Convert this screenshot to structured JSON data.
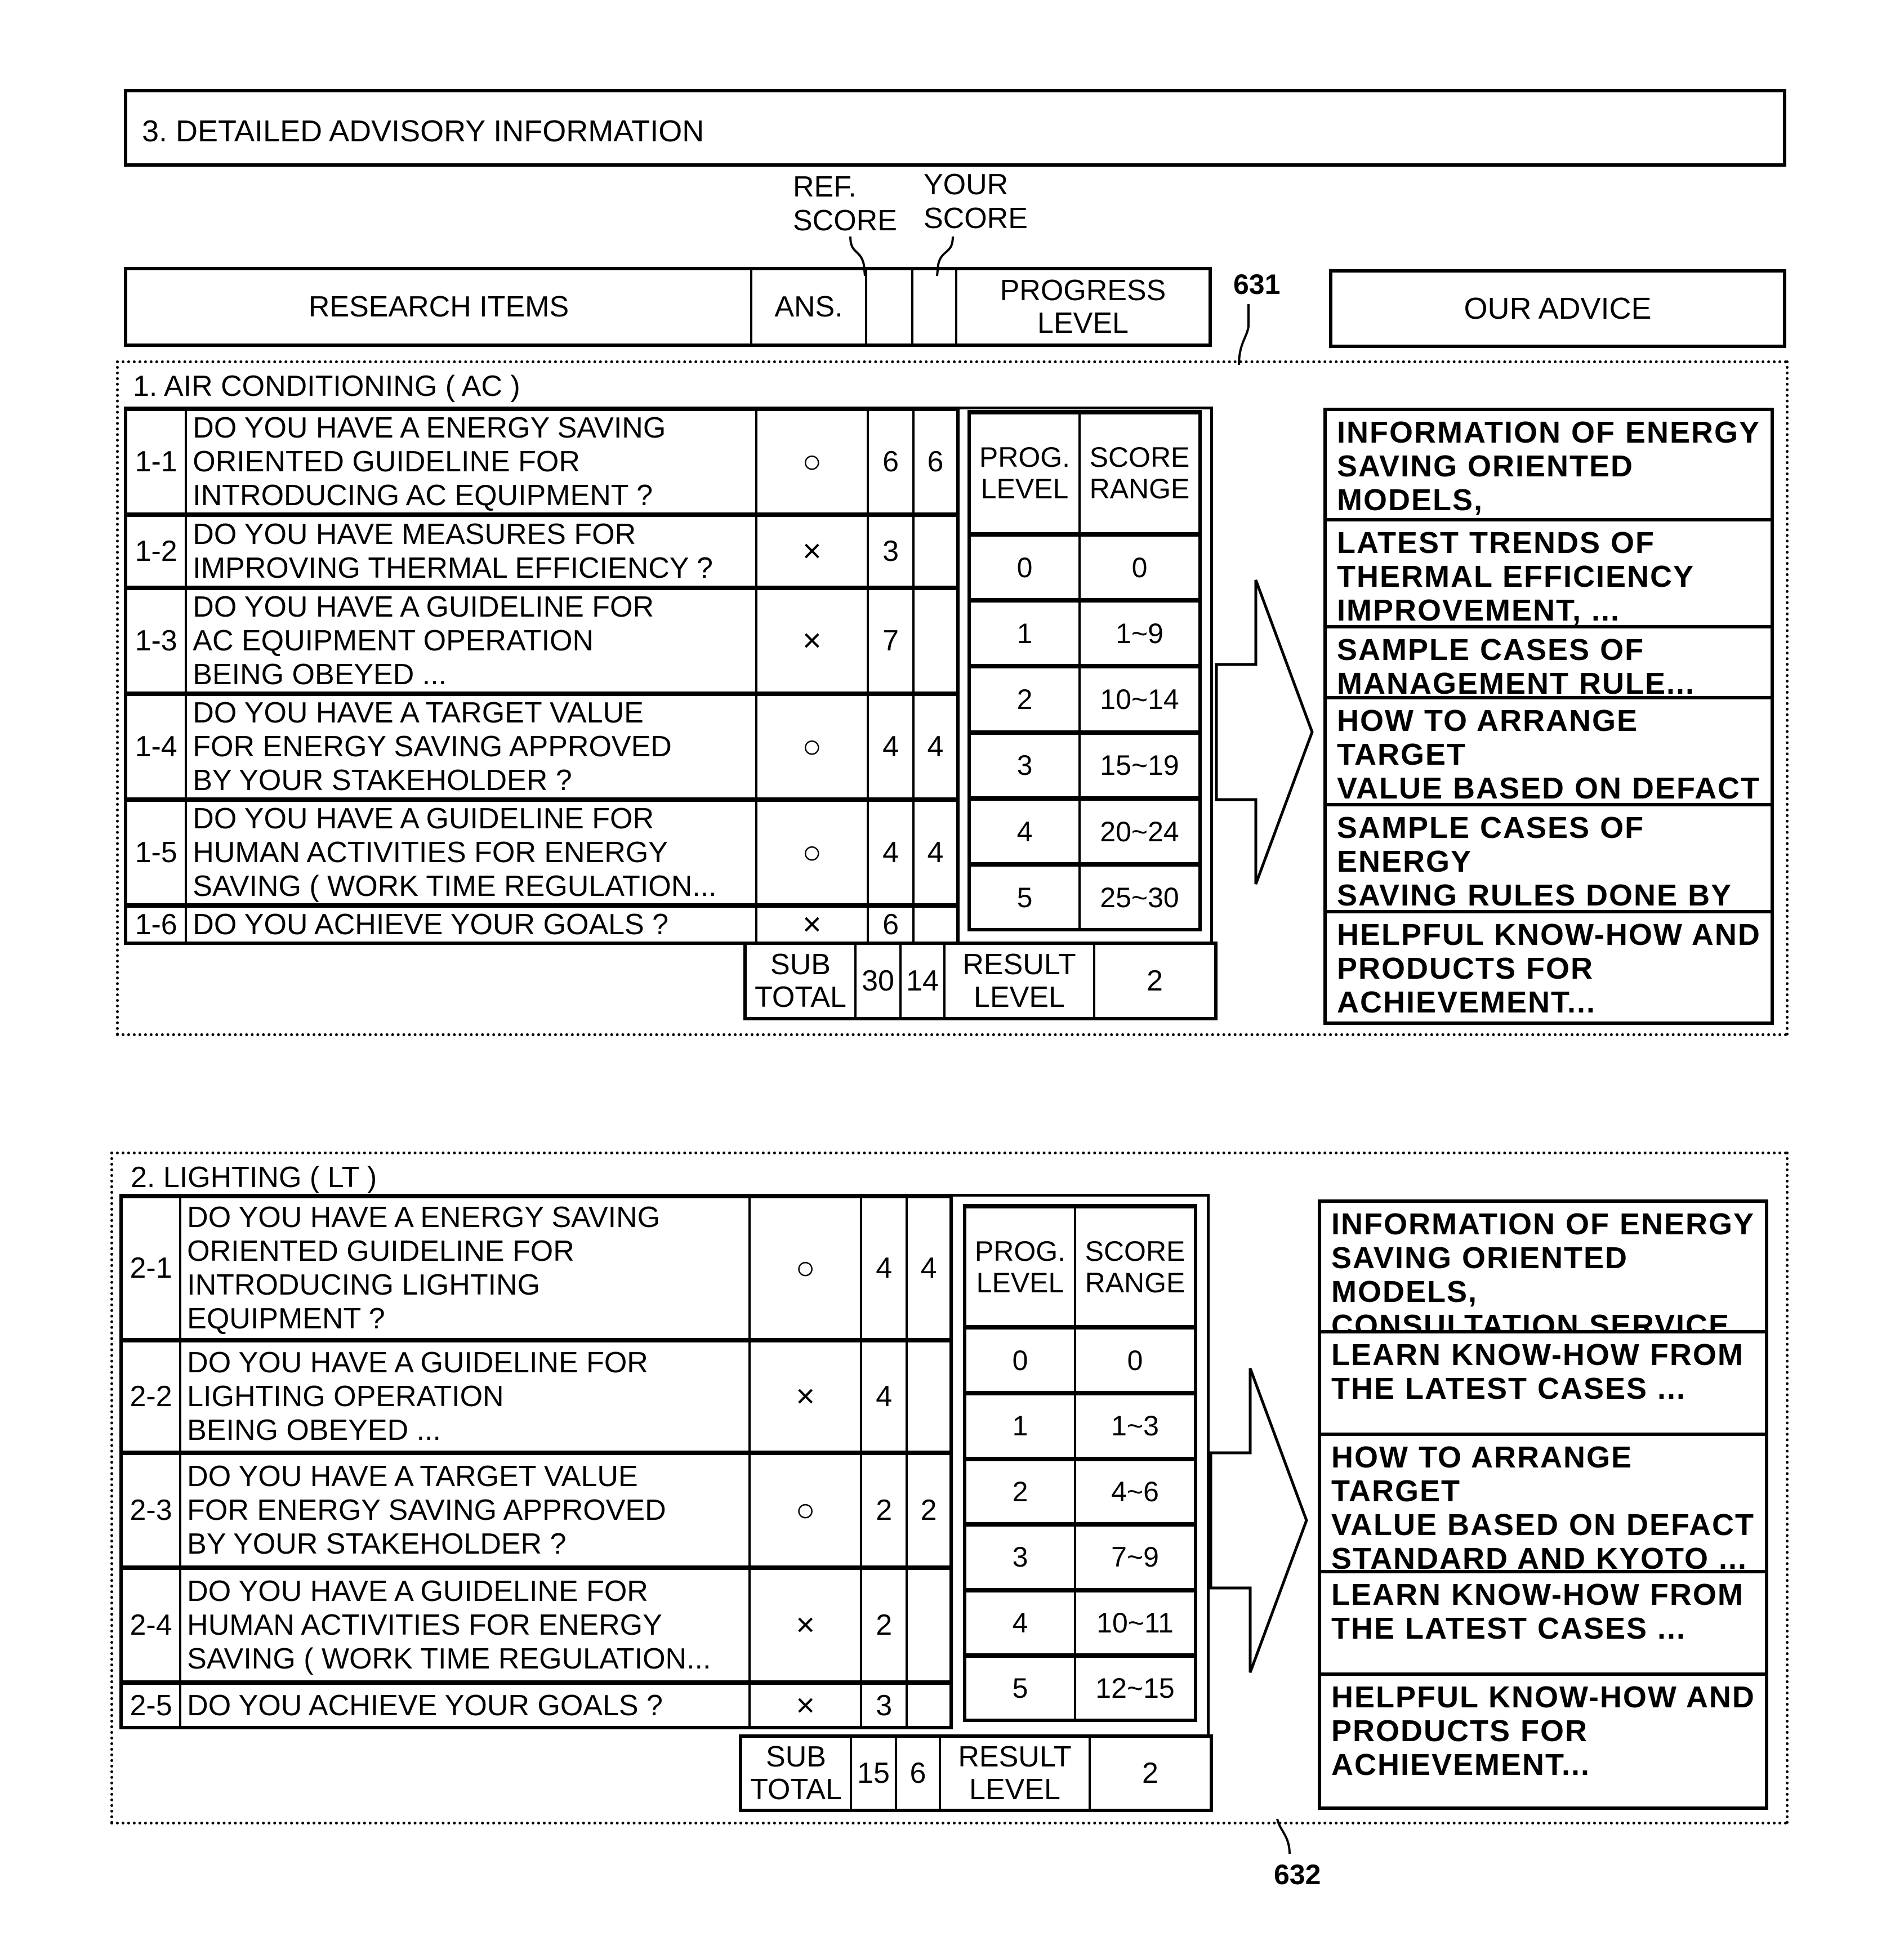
{
  "title": "3. DETAILED ADVISORY INFORMATION",
  "labels": {
    "ref_score": "REF.\nSCORE",
    "your_score": "YOUR\nSCORE",
    "ref_631": "631",
    "ref_632": "632"
  },
  "header": {
    "research_items": "RESEARCH ITEMS",
    "ans": "ANS.",
    "progress_level": "PROGRESS LEVEL",
    "our_advice": "OUR ADVICE"
  },
  "sections": [
    {
      "title": "1. AIR CONDITIONING ( AC )",
      "items": [
        {
          "id": "1-1",
          "question": "DO YOU HAVE A ENERGY SAVING\nORIENTED GUIDELINE FOR\nINTRODUCING AC EQUIPMENT ?",
          "ans": "○",
          "ref": "6",
          "yours": "6"
        },
        {
          "id": "1-2",
          "question": "DO YOU HAVE MEASURES FOR\nIMPROVING THERMAL EFFICIENCY ?",
          "ans": "×",
          "ref": "3",
          "yours": ""
        },
        {
          "id": "1-3",
          "question": "DO YOU HAVE A GUIDELINE FOR\nAC EQUIPMENT OPERATION\nBEING OBEYED ...",
          "ans": "×",
          "ref": "7",
          "yours": ""
        },
        {
          "id": "1-4",
          "question": "DO YOU HAVE A TARGET VALUE\nFOR ENERGY SAVING APPROVED\nBY YOUR STAKEHOLDER ?",
          "ans": "○",
          "ref": "4",
          "yours": "4"
        },
        {
          "id": "1-5",
          "question": "DO YOU HAVE A GUIDELINE FOR\nHUMAN ACTIVITIES FOR ENERGY\nSAVING ( WORK TIME REGULATION...",
          "ans": "○",
          "ref": "4",
          "yours": "4"
        },
        {
          "id": "1-6",
          "question": "DO YOU ACHIEVE YOUR GOALS ?",
          "ans": "×",
          "ref": "6",
          "yours": ""
        }
      ],
      "progress_table": {
        "col1": "PROG.\nLEVEL",
        "col2": "SCORE\nRANGE",
        "rows": [
          {
            "level": "0",
            "range": "0"
          },
          {
            "level": "1",
            "range": "1~9"
          },
          {
            "level": "2",
            "range": "10~14"
          },
          {
            "level": "3",
            "range": "15~19"
          },
          {
            "level": "4",
            "range": "20~24"
          },
          {
            "level": "5",
            "range": "25~30"
          }
        ]
      },
      "subtotal_label": "SUB\nTOTAL",
      "subtotal_ref": "30",
      "subtotal_yours": "14",
      "result_label": "RESULT\nLEVEL",
      "result_level": "2",
      "advice": [
        "INFORMATION OF ENERGY\nSAVING ORIENTED MODELS,\nCONSULTATION SERVICE, ...",
        "LATEST TRENDS OF\nTHERMAL EFFICIENCY\nIMPROVEMENT, ...",
        "SAMPLE CASES OF\nMANAGEMENT RULE...",
        "HOW TO ARRANGE TARGET\nVALUE BASED ON DEFACT\nSTANDARD AND KYOTO ...",
        "SAMPLE CASES OF ENERGY\nSAVING RULES DONE BY\nOUR CUSTOMERS",
        "HELPFUL KNOW-HOW AND\nPRODUCTS FOR\nACHIEVEMENT..."
      ]
    },
    {
      "title": "2. LIGHTING ( LT )",
      "items": [
        {
          "id": "2-1",
          "question": "DO YOU HAVE A ENERGY SAVING\nORIENTED GUIDELINE FOR\nINTRODUCING LIGHTING\nEQUIPMENT ?",
          "ans": "○",
          "ref": "4",
          "yours": "4"
        },
        {
          "id": "2-2",
          "question": "DO YOU HAVE A GUIDELINE FOR\nLIGHTING OPERATION\nBEING OBEYED ...",
          "ans": "×",
          "ref": "4",
          "yours": ""
        },
        {
          "id": "2-3",
          "question": "DO YOU HAVE A TARGET VALUE\nFOR ENERGY SAVING APPROVED\nBY YOUR STAKEHOLDER ?",
          "ans": "○",
          "ref": "2",
          "yours": "2"
        },
        {
          "id": "2-4",
          "question": "DO YOU HAVE A GUIDELINE FOR\nHUMAN ACTIVITIES FOR ENERGY\nSAVING ( WORK TIME REGULATION...",
          "ans": "×",
          "ref": "2",
          "yours": ""
        },
        {
          "id": "2-5",
          "question": "DO YOU ACHIEVE YOUR GOALS ?",
          "ans": "×",
          "ref": "3",
          "yours": ""
        }
      ],
      "progress_table": {
        "col1": "PROG.\nLEVEL",
        "col2": "SCORE\nRANGE",
        "rows": [
          {
            "level": "0",
            "range": "0"
          },
          {
            "level": "1",
            "range": "1~3"
          },
          {
            "level": "2",
            "range": "4~6"
          },
          {
            "level": "3",
            "range": "7~9"
          },
          {
            "level": "4",
            "range": "10~11"
          },
          {
            "level": "5",
            "range": "12~15"
          }
        ]
      },
      "subtotal_label": "SUB\nTOTAL",
      "subtotal_ref": "15",
      "subtotal_yours": "6",
      "result_label": "RESULT\nLEVEL",
      "result_level": "2",
      "advice": [
        "INFORMATION OF ENERGY\nSAVING ORIENTED MODELS,\nCONSULTATION SERVICE, ...",
        "LEARN KNOW-HOW FROM\nTHE LATEST CASES ...",
        "HOW TO ARRANGE TARGET\nVALUE BASED ON DEFACT\nSTANDARD AND KYOTO ...",
        "LEARN KNOW-HOW FROM\nTHE LATEST CASES ...",
        "HELPFUL KNOW-HOW AND\nPRODUCTS FOR\nACHIEVEMENT..."
      ]
    }
  ]
}
